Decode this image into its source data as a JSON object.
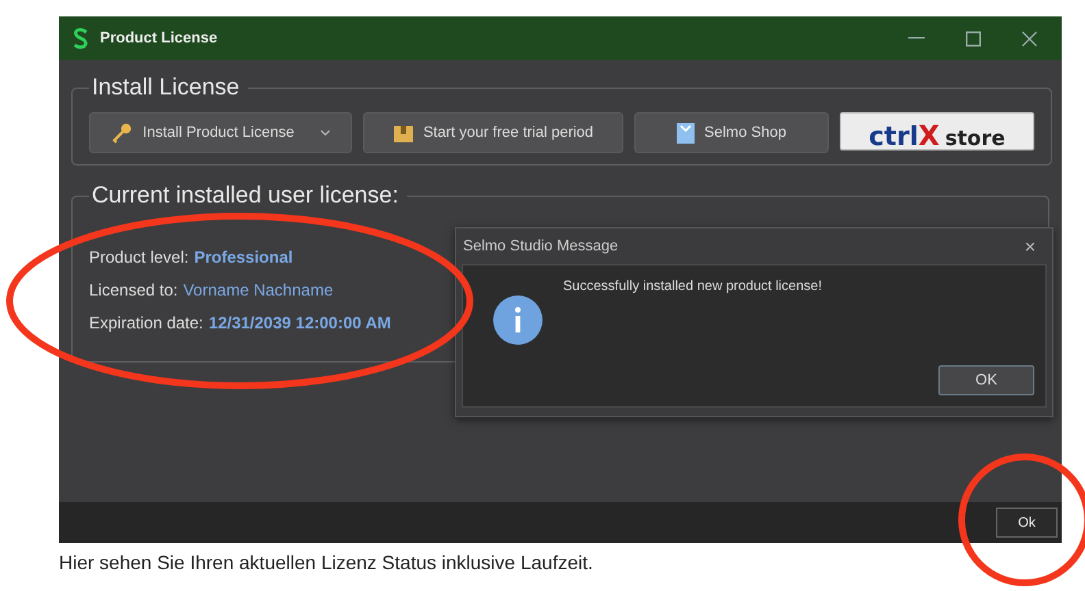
{
  "window": {
    "title": "Product License"
  },
  "install_group": {
    "title": "Install License",
    "buttons": [
      {
        "label": "Install Product License",
        "kind": "dropdown"
      },
      {
        "label": "Start your free trial period",
        "kind": "trial"
      },
      {
        "label": "Selmo Shop",
        "kind": "shop"
      }
    ],
    "store_button": {
      "parts": [
        {
          "text": "ctrl",
          "kind": "brand"
        },
        {
          "text": "X",
          "kind": "accent"
        },
        {
          "text": "store",
          "kind": "plain"
        }
      ]
    }
  },
  "license_group": {
    "title": "Current installed user license:",
    "rows": [
      {
        "label": "Product level:",
        "value": "Professional",
        "bold": true
      },
      {
        "label": "Licensed to:",
        "value": "Vorname Nachname",
        "bold": false
      },
      {
        "label": "Expiration date:",
        "value": "12/31/2039 12:00:00 AM",
        "bold": true
      }
    ]
  },
  "message_dialog": {
    "title": "Selmo Studio Message",
    "close": "×",
    "message": "Successfully installed new product license!",
    "button": "OK"
  },
  "footer": {
    "button": "Ok"
  },
  "caption": "Hier sehen Sie Ihren aktuellen Lizenz Status inklusive Laufzeit."
}
